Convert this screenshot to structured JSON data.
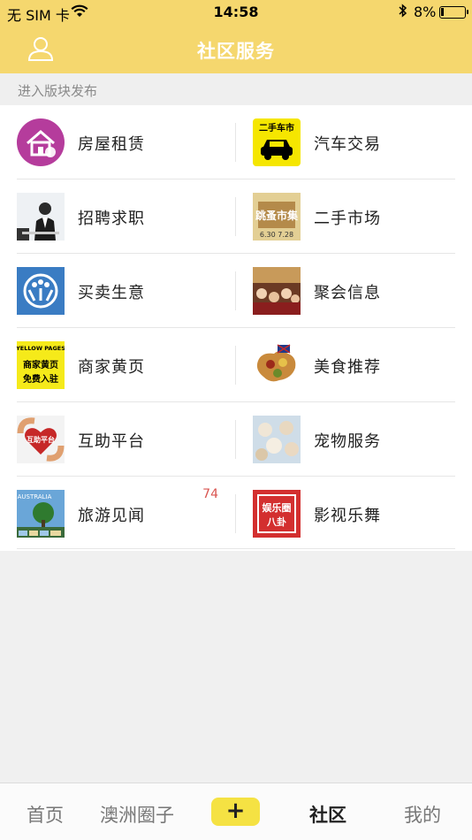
{
  "status_bar": {
    "carrier": "无 SIM 卡",
    "time": "14:58",
    "battery": "8%"
  },
  "nav": {
    "title": "社区服务",
    "left_icon": "user-icon"
  },
  "section": {
    "header": "进入版块发布"
  },
  "grid": {
    "items": [
      {
        "label": "房屋租赁",
        "icon": "house-icon"
      },
      {
        "label": "汽车交易",
        "icon": "car-icon",
        "thumb_text": "二手车市"
      },
      {
        "label": "招聘求职",
        "icon": "job-icon"
      },
      {
        "label": "二手市场",
        "icon": "market-icon",
        "thumb_text": "跳蚤市集",
        "thumb_sub": "6.30 7.28"
      },
      {
        "label": "买卖生意",
        "icon": "business-icon"
      },
      {
        "label": "聚会信息",
        "icon": "party-icon"
      },
      {
        "label": "商家黄页",
        "icon": "yellow-pages-icon",
        "thumb_text": "YELLOW PAGES",
        "thumb_sub": "商家黄页",
        "thumb_sub2": "免费入驻"
      },
      {
        "label": "美食推荐",
        "icon": "food-icon"
      },
      {
        "label": "互助平台",
        "icon": "mutual-aid-icon",
        "thumb_text": "互助平台"
      },
      {
        "label": "宠物服务",
        "icon": "pet-icon"
      },
      {
        "label": "旅游见闻",
        "icon": "travel-icon",
        "badge": "74",
        "thumb_text": "AUSTRALIA"
      },
      {
        "label": "影视乐舞",
        "icon": "entertainment-icon",
        "thumb_text": "娱乐圈",
        "thumb_sub": "八卦"
      }
    ]
  },
  "tabs": {
    "home": "首页",
    "circle": "澳洲圈子",
    "plus": "+",
    "community": "社区",
    "mine": "我的"
  }
}
